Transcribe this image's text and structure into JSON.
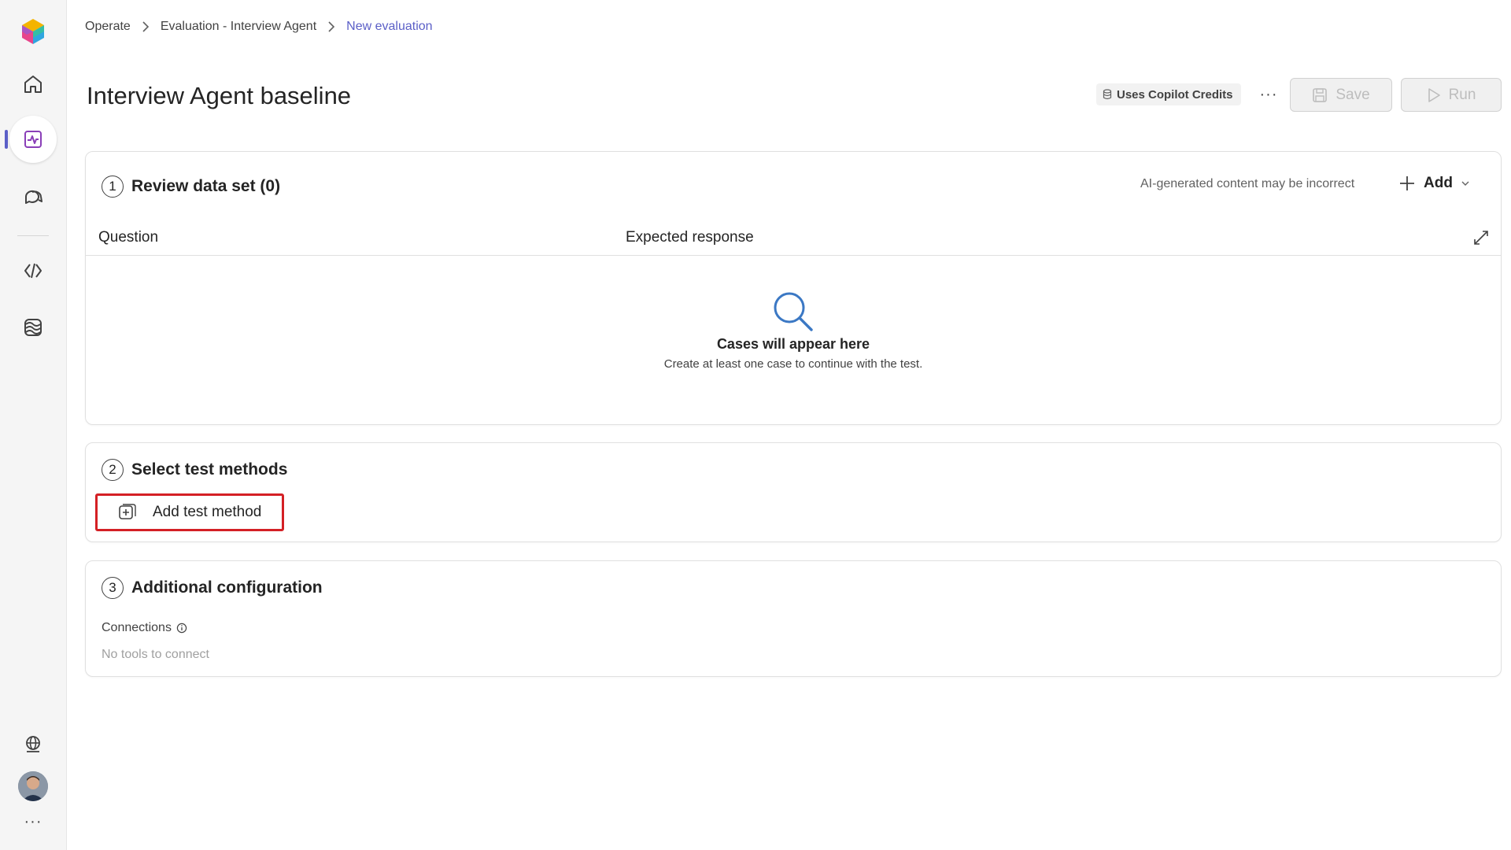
{
  "breadcrumb": {
    "items": [
      "Operate",
      "Evaluation - Interview Agent"
    ],
    "current": "New evaluation"
  },
  "header": {
    "title": "Interview Agent baseline",
    "credits_label": "Uses Copilot Credits",
    "more_label": "···",
    "save_label": "Save",
    "run_label": "Run"
  },
  "dataset": {
    "step": "1",
    "title": "Review data set (0)",
    "ai_note": "AI-generated content may be incorrect",
    "add_label": "Add",
    "columns": [
      "Question",
      "Expected response"
    ],
    "empty_title": "Cases will appear here",
    "empty_subtitle": "Create at least one case to continue with the test."
  },
  "methods": {
    "step": "2",
    "title": "Select test methods",
    "add_method_label": "Add test method"
  },
  "config": {
    "step": "3",
    "title": "Additional configuration",
    "connections_label": "Connections",
    "connections_empty": "No tools to connect"
  },
  "rail": {
    "items": [
      "home-icon",
      "evaluation-icon",
      "chat-icon",
      "code-icon",
      "models-icon",
      "globe-icon",
      "more-icon"
    ],
    "more_label": "···"
  },
  "colors": {
    "accent": "#5b5fc7",
    "highlight_border": "#d42025"
  }
}
